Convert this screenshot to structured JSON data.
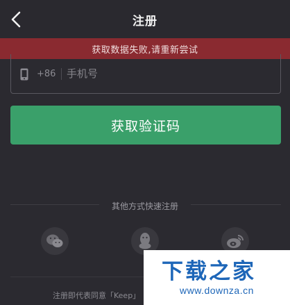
{
  "header": {
    "title": "注册",
    "back_icon": "chevron-left-icon"
  },
  "error_banner": {
    "text": "获取数据失败,请重新尝试",
    "color": "#8a2a30"
  },
  "phone_field": {
    "icon": "mobile-phone-icon",
    "country_code": "+86",
    "placeholder": "手机号",
    "value": ""
  },
  "get_code_button": {
    "label": "获取验证码",
    "color": "#3aa06a"
  },
  "other_login": {
    "label": "其他方式快速注册",
    "options": [
      {
        "icon": "wechat-icon"
      },
      {
        "icon": "qq-icon"
      },
      {
        "icon": "weibo-icon"
      }
    ]
  },
  "agreement": {
    "text": "注册即代表同意「Keep」"
  },
  "watermark": {
    "title": "下载之家",
    "url": "www.downza.cn"
  }
}
